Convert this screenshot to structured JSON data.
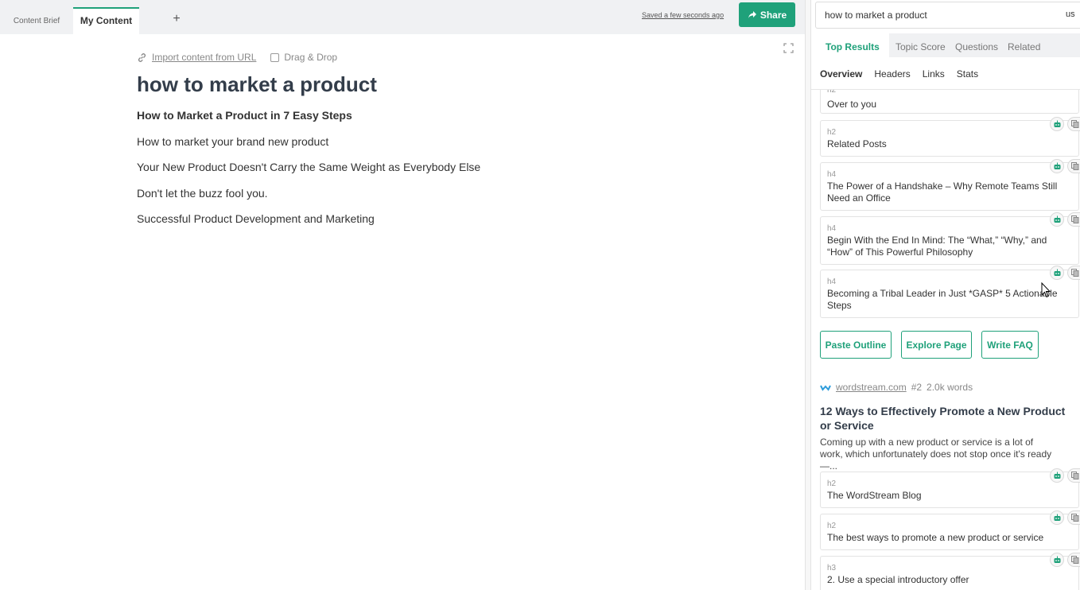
{
  "tabs": {
    "brief": "Content Brief",
    "mine": "My Content",
    "add": "+"
  },
  "saved_text": "Saved a few seconds ago",
  "share_label": "Share",
  "editor": {
    "import_label": "Import content from URL",
    "drag_drop_label": "Drag & Drop",
    "title": "how to market a product",
    "lines": [
      "How to Market a Product in 7 Easy Steps",
      "How to market your brand new product",
      "Your New Product Doesn't Carry the Same Weight as Everybody Else",
      "Don't let the buzz fool you.",
      "Successful Product Development and Marketing"
    ]
  },
  "panel": {
    "search_value": "how to market a product",
    "locale": "us",
    "tabs": [
      "Top Results",
      "Topic Score",
      "Questions",
      "Related"
    ],
    "subtabs": [
      "Overview",
      "Headers",
      "Links",
      "Stats"
    ],
    "headers_top": [
      {
        "level": "h2",
        "text": "Over to you"
      },
      {
        "level": "h2",
        "text": "Related Posts"
      },
      {
        "level": "h4",
        "text": "The Power of a Handshake – Why Remote Teams Still Need an Office"
      },
      {
        "level": "h4",
        "text": "Begin With the End In Mind: The “What,” “Why,” and “How” of This Powerful Philosophy"
      },
      {
        "level": "h4",
        "text": "Becoming a Tribal Leader in Just *GASP* 5 Actionable Steps"
      }
    ],
    "buttons": [
      "Paste Outline",
      "Explore Page",
      "Write FAQ"
    ],
    "result": {
      "domain": "wordstream.com",
      "rank": "#2",
      "words": "2.0k words",
      "title": "12 Ways to Effectively Promote a New Product or Service",
      "description": "Coming up with a new product or service is a lot of work, which unfortunately does not stop once it's ready—...",
      "headers": [
        {
          "level": "h2",
          "text": "The WordStream Blog"
        },
        {
          "level": "h2",
          "text": "The best ways to promote a new product or service"
        },
        {
          "level": "h3",
          "text": "2. Use a special introductory offer"
        }
      ]
    }
  },
  "colors": {
    "accent": "#1fa17a"
  }
}
